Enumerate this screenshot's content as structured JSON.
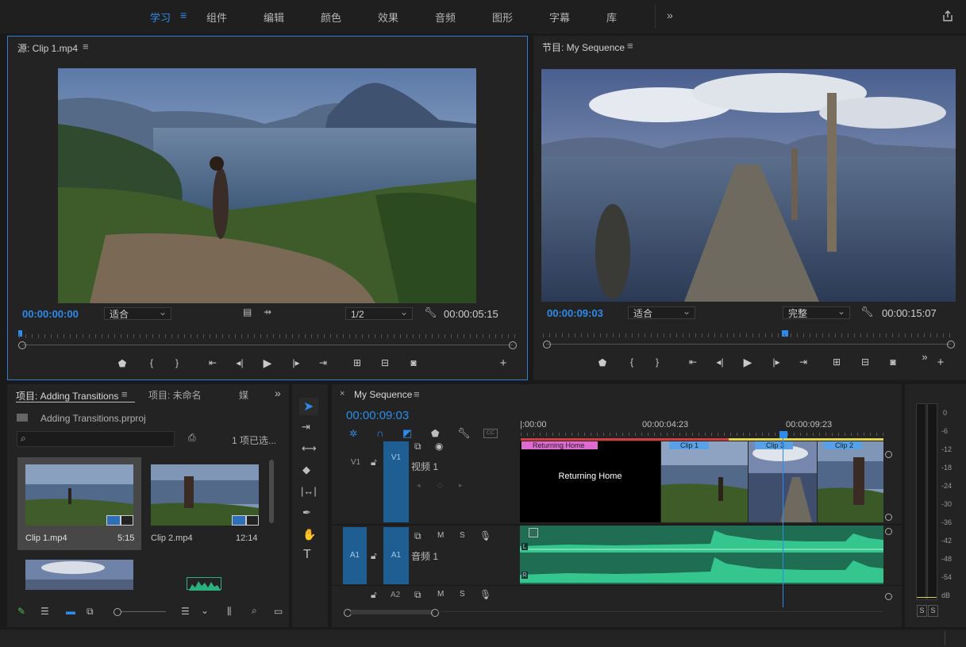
{
  "colors": {
    "accent": "#2d8ceb",
    "audio": "#2bb07f",
    "title_clip": "#000000",
    "clip_label_pink": "#e06bd0",
    "clip_label_blue": "#5aa0e6",
    "work_bar_yellow": "#e2d44a",
    "work_bar_red": "#d13c3c"
  },
  "workspaces": {
    "tabs": [
      "学习",
      "组件",
      "编辑",
      "颜色",
      "效果",
      "音频",
      "图形",
      "字幕",
      "库"
    ],
    "menu_icon": "hamburger-icon",
    "more_icon": "double-chevron-icon",
    "export_icon": "share-icon"
  },
  "source": {
    "tab_label": "源: Clip 1.mp4",
    "timecode_in": "00:00:00:00",
    "fit": "适合",
    "resolution": "1/2",
    "duration": "00:00:05:15"
  },
  "program": {
    "tab_label": "节目: My Sequence",
    "timecode_in": "00:00:09:03",
    "fit": "适合",
    "resolution": "完整",
    "duration": "00:00:15:07"
  },
  "project": {
    "tab_active": "项目: Adding Transitions",
    "tab_other": "项目: 未命名",
    "tab_media": "媒",
    "file": "Adding Transitions.prproj",
    "count": "1 项已选...",
    "items": [
      {
        "name": "Clip 1.mp4",
        "duration": "5:15"
      },
      {
        "name": "Clip 2.mp4",
        "duration": "12:14"
      }
    ]
  },
  "timeline": {
    "tab": "My Sequence",
    "timecode": "00:00:09:03",
    "ruler": [
      "|:00:00",
      "00:00:04:23",
      "00:00:09:23"
    ],
    "v1_name": "视频 1",
    "a1_name": "音频 1",
    "tracks": {
      "v1": "V1",
      "a1": "A1",
      "a2": "A2"
    },
    "clips": [
      {
        "name": "Returning Home",
        "title": "Returning Home"
      },
      {
        "name": "Clip 1"
      },
      {
        "name": "Clip 3"
      },
      {
        "name": "Clip 2"
      }
    ],
    "m": "M",
    "s": "S",
    "L": "L",
    "R": "R"
  },
  "meter": {
    "scale": [
      "0",
      "-6",
      "-12",
      "-18",
      "-24",
      "-30",
      "-36",
      "-42",
      "-48",
      "-54",
      "dB"
    ],
    "solo": [
      "S",
      "S"
    ]
  }
}
